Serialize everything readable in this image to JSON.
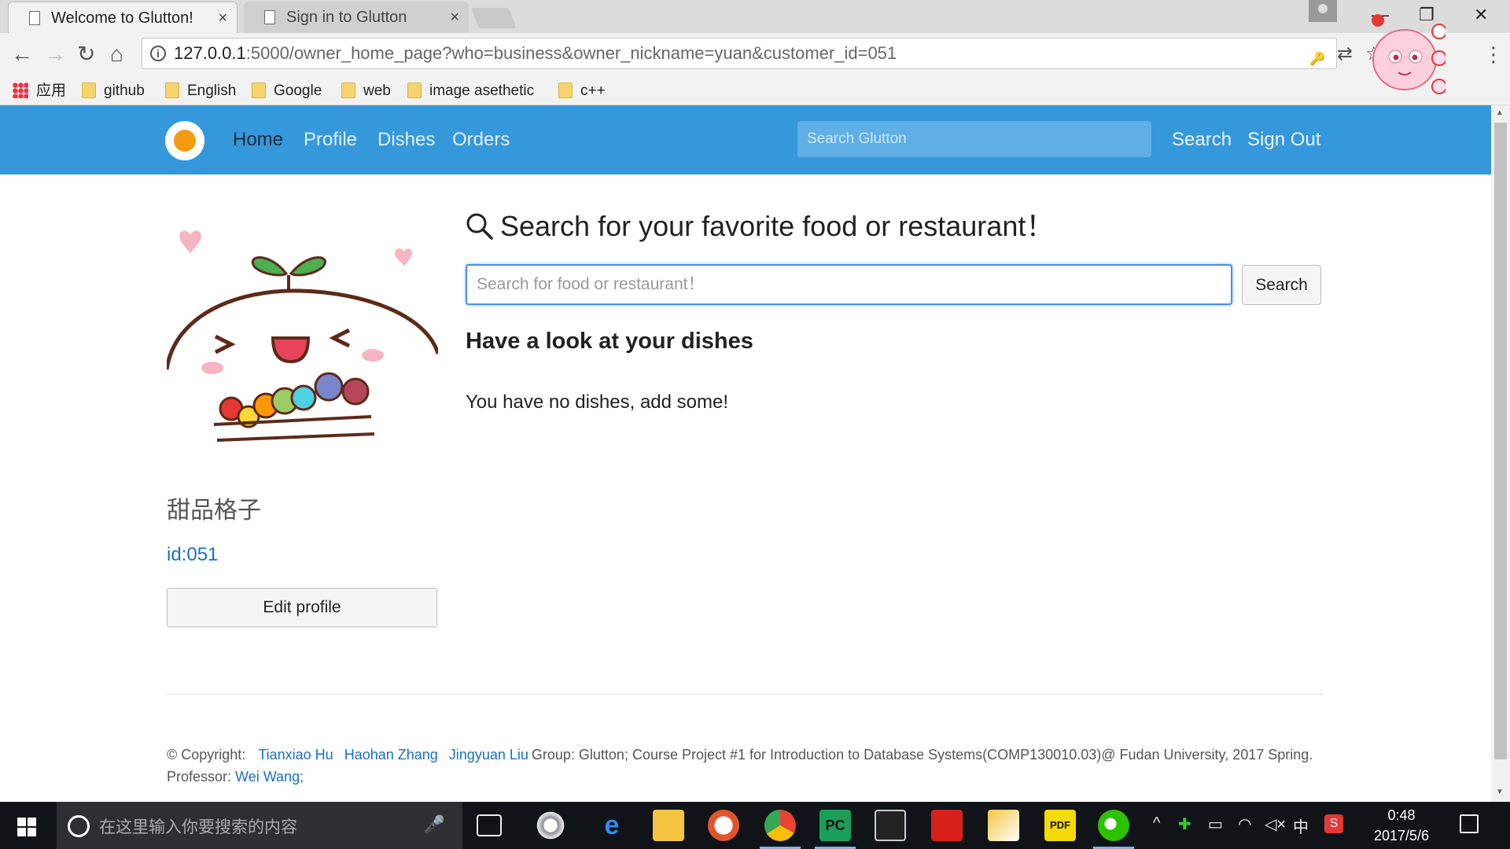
{
  "browser": {
    "tabs": [
      {
        "title": "Welcome to Glutton!",
        "close": "×"
      },
      {
        "title": "Sign in to Glutton",
        "close": "×"
      }
    ],
    "url_host": "127.0.0.1",
    "url_rest": ":5000/owner_home_page?who=business&owner_nickname=yuan&customer_id=051",
    "info_glyph": "i",
    "bookmarks": [
      "应用",
      "github",
      "English",
      "Google",
      "web",
      "image  asethetic",
      "c++"
    ],
    "nav_icons": {
      "back": "←",
      "forward": "→",
      "reload": "↻",
      "home": "⌂",
      "menu": "⋮",
      "star": "☆",
      "key": "🔑",
      "translate": "⇄"
    },
    "window_controls": {
      "minimize": "—",
      "restore": "❐",
      "close": "✕"
    }
  },
  "navbar": {
    "links": [
      "Home",
      "Profile",
      "Dishes",
      "Orders"
    ],
    "search_placeholder": "Search Glutton",
    "search_label": "Search",
    "signout_label": "Sign Out",
    "brand_color": "#3498db"
  },
  "profile": {
    "name": "甜品格子",
    "id_text": "id:051",
    "edit_label": "Edit profile"
  },
  "main": {
    "search_title": "Search for your favorite food or restaurant！",
    "search_placeholder": "Search for food or restaurant！",
    "search_button": "Search",
    "dishes_heading": "Have a look at your dishes",
    "dishes_empty": "You have no dishes, add some!"
  },
  "footer": {
    "copyright": "© Copyright:",
    "authors": [
      "Tianxiao Hu",
      "Haohan Zhang",
      "Jingyuan Liu"
    ],
    "group_text": "Group: Glutton; Course Project #1 for Introduction to Database Systems(COMP130010.03)@ Fudan University, 2017 Spring.",
    "professor_label": "Professor:",
    "professor_name": "Wei Wang",
    "professor_suffix": ";"
  },
  "taskbar": {
    "search_placeholder": "在这里输入你要搜索的内容",
    "time": "0:48",
    "date": "2017/5/6",
    "ime": "中",
    "apps": [
      "task-view",
      "pinwheel",
      "edge",
      "file-explorer",
      "media",
      "chrome",
      "pycharm",
      "terminal",
      "acrobat",
      "notes",
      "pdf",
      "wechat"
    ]
  }
}
